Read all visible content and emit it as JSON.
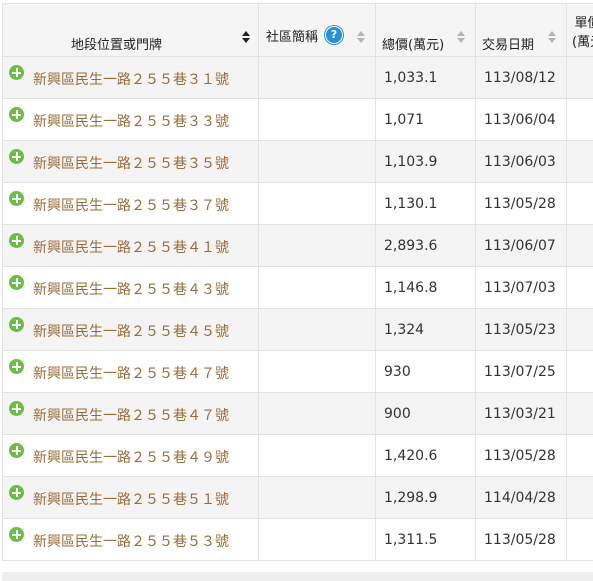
{
  "table": {
    "columns": [
      {
        "label": "地段位置或門牌",
        "sortable": true,
        "help": false
      },
      {
        "label": "社區簡稱",
        "sortable": true,
        "help": true
      },
      {
        "label": "總價(萬元)",
        "sortable": true,
        "help": false
      },
      {
        "label": "交易日期",
        "sortable": true,
        "help": false
      },
      {
        "label": "單價\n(萬元",
        "sortable": false,
        "help": false
      }
    ],
    "help_glyph": "?",
    "rows": [
      {
        "address": "新興區民生一路２５５巷３１號",
        "community": "",
        "total_price": "1,033.1",
        "date": "113/08/12",
        "unit_price": ""
      },
      {
        "address": "新興區民生一路２５５巷３３號",
        "community": "",
        "total_price": "1,071",
        "date": "113/06/04",
        "unit_price": ""
      },
      {
        "address": "新興區民生一路２５５巷３５號",
        "community": "",
        "total_price": "1,103.9",
        "date": "113/06/03",
        "unit_price": ""
      },
      {
        "address": "新興區民生一路２５５巷３７號",
        "community": "",
        "total_price": "1,130.1",
        "date": "113/05/28",
        "unit_price": ""
      },
      {
        "address": "新興區民生一路２５５巷４１號",
        "community": "",
        "total_price": "2,893.6",
        "date": "113/06/07",
        "unit_price": ""
      },
      {
        "address": "新興區民生一路２５５巷４３號",
        "community": "",
        "total_price": "1,146.8",
        "date": "113/07/03",
        "unit_price": ""
      },
      {
        "address": "新興區民生一路２５５巷４５號",
        "community": "",
        "total_price": "1,324",
        "date": "113/05/23",
        "unit_price": ""
      },
      {
        "address": "新興區民生一路２５５巷４７號",
        "community": "",
        "total_price": "930",
        "date": "113/07/25",
        "unit_price": ""
      },
      {
        "address": "新興區民生一路２５５巷４７號",
        "community": "",
        "total_price": "900",
        "date": "113/03/21",
        "unit_price": ""
      },
      {
        "address": "新興區民生一路２５５巷４９號",
        "community": "",
        "total_price": "1,420.6",
        "date": "113/05/28",
        "unit_price": ""
      },
      {
        "address": "新興區民生一路２５５巷５１號",
        "community": "",
        "total_price": "1,298.9",
        "date": "114/04/28",
        "unit_price": ""
      },
      {
        "address": "新興區民生一路２５５巷５３號",
        "community": "",
        "total_price": "1,311.5",
        "date": "113/05/28",
        "unit_price": ""
      }
    ]
  },
  "colors": {
    "link": "#9b6b3a",
    "expand_icon": "#6cbd45",
    "help_icon": "#2a8ed6",
    "header_bg": "#f5f5f5",
    "row_stripe": "#f4f4f4"
  },
  "icons": {
    "expand": "plus-circle-icon",
    "help": "question-circle-icon",
    "sort": "sort-arrows-icon"
  }
}
